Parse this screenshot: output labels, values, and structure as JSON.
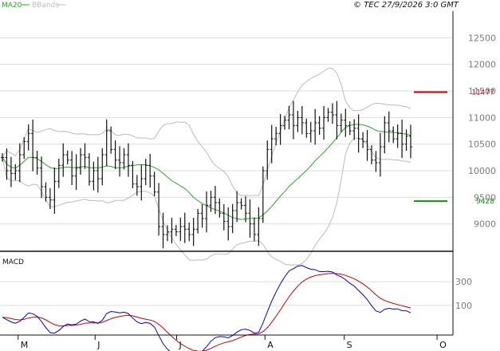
{
  "header": {
    "legend": [
      {
        "label": "MA20",
        "color": "#22aa22"
      },
      {
        "label": "BBands",
        "color": "#bbbbbb"
      }
    ],
    "copyright": "© TEC 27/9/2026 3:0 GMT"
  },
  "chart_data": [
    {
      "type": "ohlc",
      "panel": "price",
      "y_ticks": [
        9000,
        9500,
        10000,
        10500,
        11000,
        11500,
        12000,
        12500
      ],
      "y_tick_labels": [
        "9000",
        "9500",
        "10000",
        "10500",
        "11000",
        "11500",
        "12000",
        "12500"
      ],
      "ylim": [
        8500,
        13000
      ],
      "x_labels": [
        "M",
        "J",
        "J",
        "A",
        "S",
        "O"
      ],
      "grid": true,
      "markers": [
        {
          "label": "11477",
          "value": 11477,
          "color": "#cc0000"
        },
        {
          "label": "9428",
          "value": 9428,
          "color": "#009900"
        }
      ],
      "closes": [
        10250,
        10000,
        9950,
        10000,
        10300,
        10550,
        10700,
        10250,
        10050,
        9700,
        9500,
        9450,
        9800,
        10100,
        10300,
        10200,
        9900,
        10050,
        10300,
        10250,
        9800,
        10000,
        9850,
        10300,
        10750,
        10400,
        10200,
        10150,
        10300,
        10100,
        9750,
        9700,
        9850,
        10100,
        9900,
        9600,
        8950,
        8800,
        8850,
        8900,
        8850,
        8950,
        8900,
        8800,
        8900,
        9200,
        9100,
        9350,
        9500,
        9400,
        9200,
        9050,
        8950,
        9250,
        9400,
        9350,
        9200,
        9000,
        8800,
        9100,
        10000,
        10400,
        10600,
        10700,
        10850,
        10950,
        11050,
        10850,
        11000,
        10900,
        10700,
        10750,
        10900,
        10800,
        11000,
        11100,
        11050,
        10850,
        10950,
        10850,
        10750,
        10800,
        10600,
        10550,
        10400,
        10200,
        10150,
        10450,
        10900,
        10750,
        10600,
        10700,
        10500,
        10650,
        10450
      ],
      "series": [
        {
          "name": "MA20",
          "color": "#22aa22",
          "role": "moving-average-20"
        },
        {
          "name": "BBands",
          "color": "#bbbbbb",
          "role": "bollinger-bands"
        }
      ]
    },
    {
      "type": "line",
      "panel": "indicator",
      "title": "MACD",
      "y_ticks": [
        100,
        300
      ],
      "y_tick_labels": [
        "100",
        "300"
      ],
      "ylim": [
        -150,
        550
      ],
      "grid": true,
      "series": [
        {
          "color": "#0000cc",
          "role": "macd"
        },
        {
          "color": "#cc0000",
          "role": "signal"
        }
      ]
    }
  ]
}
